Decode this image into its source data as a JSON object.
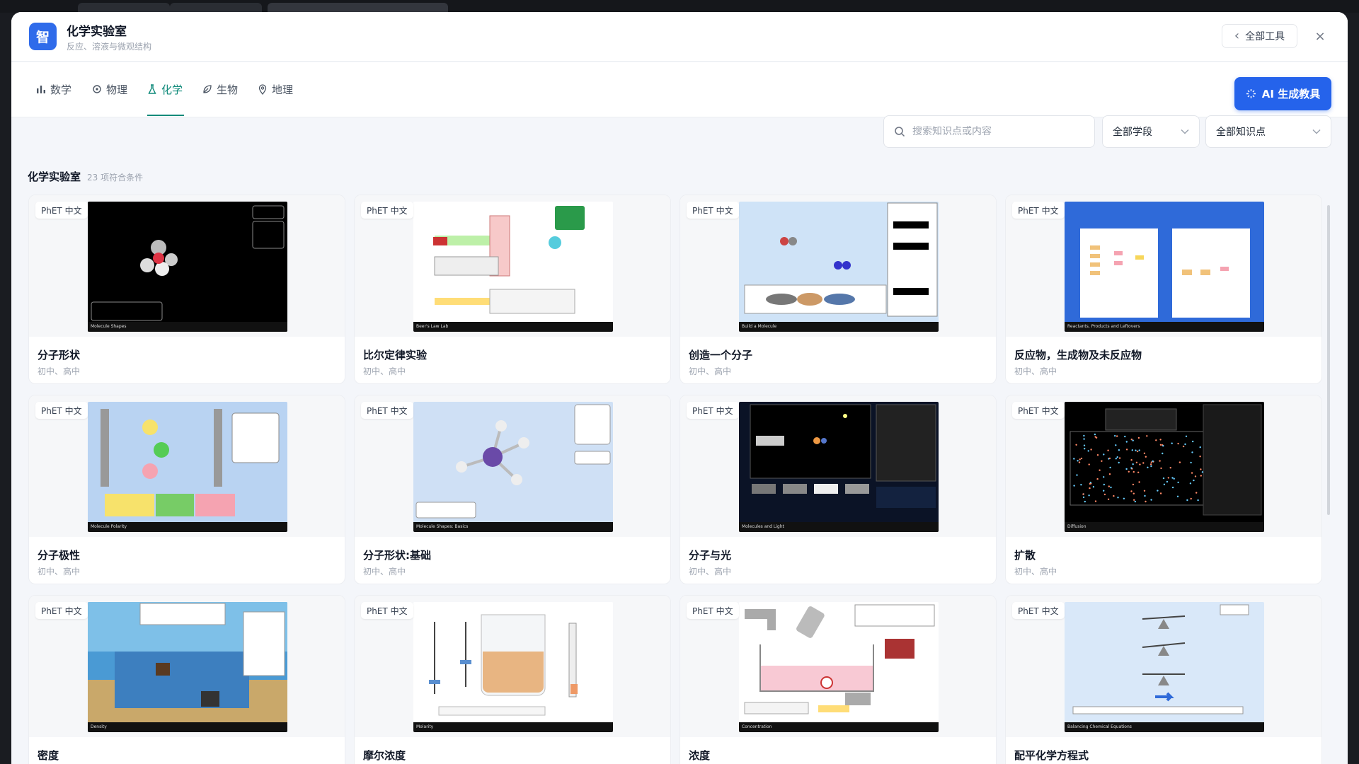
{
  "app": {
    "logo_char": "智",
    "title": "化学实验室",
    "subtitle": "反应、溶液与微观结构",
    "all_tools_label": "全部工具",
    "close_glyph": "×",
    "back_glyph": "‹"
  },
  "nav": {
    "tabs": [
      {
        "label": "数学",
        "icon": "bar-chart-icon",
        "active": false
      },
      {
        "label": "物理",
        "icon": "atom-icon",
        "active": false
      },
      {
        "label": "化学",
        "icon": "flask-icon",
        "active": true
      },
      {
        "label": "生物",
        "icon": "leaf-icon",
        "active": false
      },
      {
        "label": "地理",
        "icon": "map-pin-icon",
        "active": false
      }
    ],
    "ai_button_label": "AI 生成教具"
  },
  "filters": {
    "search_placeholder": "搜索知识点或内容",
    "stage_select": "全部学段",
    "topic_select": "全部知识点"
  },
  "section": {
    "title": "化学实验室",
    "count_text": "23 项符合条件"
  },
  "cards": [
    {
      "badge": "PhET 中文",
      "title": "分子形状",
      "level": "初中、高中",
      "sim_footer": "Molecule Shapes"
    },
    {
      "badge": "PhET 中文",
      "title": "比尔定律实验",
      "level": "初中、高中",
      "sim_footer": "Beer's Law Lab"
    },
    {
      "badge": "PhET 中文",
      "title": "创造一个分子",
      "level": "初中、高中",
      "sim_footer": "Build a Molecule"
    },
    {
      "badge": "PhET 中文",
      "title": "反应物，生成物及未反应物",
      "level": "初中、高中",
      "sim_footer": "Reactants, Products and Leftovers"
    },
    {
      "badge": "PhET 中文",
      "title": "分子极性",
      "level": "初中、高中",
      "sim_footer": "Molecule Polarity"
    },
    {
      "badge": "PhET 中文",
      "title": "分子形状:基础",
      "level": "初中、高中",
      "sim_footer": "Molecule Shapes: Basics"
    },
    {
      "badge": "PhET 中文",
      "title": "分子与光",
      "level": "初中、高中",
      "sim_footer": "Molecules and Light"
    },
    {
      "badge": "PhET 中文",
      "title": "扩散",
      "level": "初中、高中",
      "sim_footer": "Diffusion"
    },
    {
      "badge": "PhET 中文",
      "title": "密度",
      "level": "",
      "sim_footer": "Density"
    },
    {
      "badge": "PhET 中文",
      "title": "摩尔浓度",
      "level": "",
      "sim_footer": "Molarity"
    },
    {
      "badge": "PhET 中文",
      "title": "浓度",
      "level": "",
      "sim_footer": "Concentration"
    },
    {
      "badge": "PhET 中文",
      "title": "配平化学方程式",
      "level": "",
      "sim_footer": "Balancing Chemical Equations"
    }
  ],
  "colors": {
    "brand_blue": "#2563eb",
    "active_teal": "#0f8a7a",
    "page_bg": "#f4f6fa"
  }
}
